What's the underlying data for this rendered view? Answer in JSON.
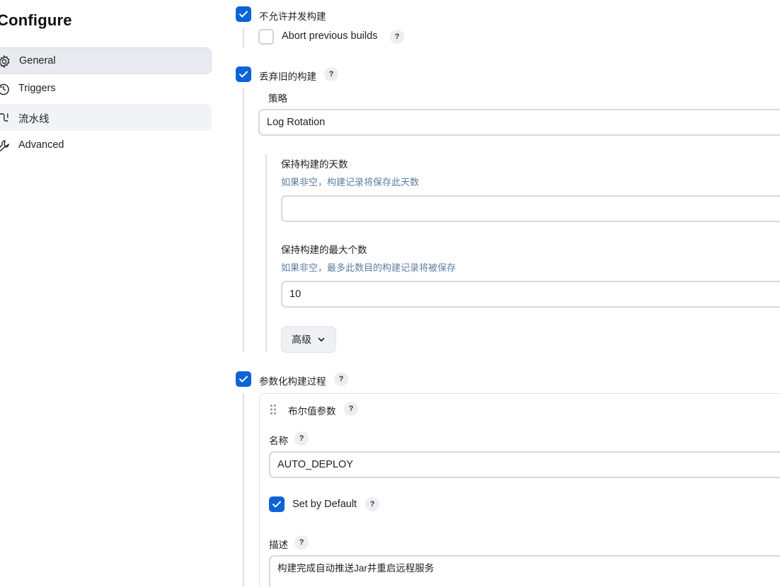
{
  "page": {
    "title": "Configure"
  },
  "sidebar": {
    "items": [
      {
        "label": "General",
        "icon": "gear-icon"
      },
      {
        "label": "Triggers",
        "icon": "clock-icon"
      },
      {
        "label": "流水线",
        "icon": "pipeline-icon"
      },
      {
        "label": "Advanced",
        "icon": "wrench-icon"
      }
    ]
  },
  "general": {
    "no_concurrent": {
      "label": "不允许并发构建",
      "checked": true
    },
    "abort_previous": {
      "label": "Abort previous builds",
      "checked": false,
      "help": "?"
    },
    "discard_old": {
      "label": "丢弃旧的构建",
      "checked": true,
      "help": "?"
    },
    "strategy": {
      "label": "策略",
      "value": "Log Rotation",
      "days_to_keep": {
        "label": "保持构建的天数",
        "hint": "如果非空，构建记录将保存此天数",
        "value": ""
      },
      "max_builds": {
        "label": "保持构建的最大个数",
        "hint": "如果非空，最多此数目的构建记录将被保存",
        "value": "10"
      },
      "advanced_button": "高级"
    },
    "parameterized": {
      "label": "参数化构建过程",
      "checked": true,
      "help": "?",
      "param": {
        "type_label": "布尔值参数",
        "name_label": "名称",
        "name_value": "AUTO_DEPLOY",
        "default_label": "Set by Default",
        "default_checked": true,
        "desc_label": "描述",
        "desc_value": "构建完成自动推送Jar并重启远程服务"
      }
    }
  },
  "colors": {
    "accent": "#0b64d8",
    "hint": "#5e7da1",
    "active_nav": "#e8eaf0"
  }
}
